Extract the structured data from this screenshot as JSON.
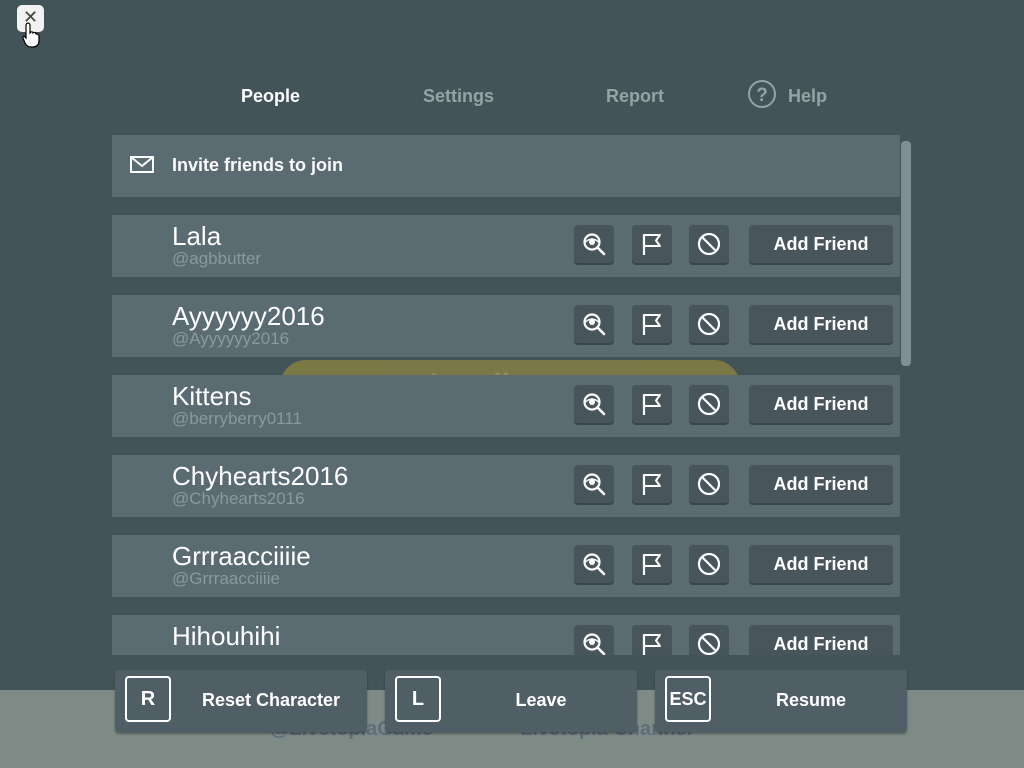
{
  "close": {
    "glyph": "✕"
  },
  "tabs": [
    {
      "label": "People",
      "active": true
    },
    {
      "label": "Settings",
      "active": false
    },
    {
      "label": "Report",
      "active": false
    },
    {
      "label": "Help",
      "active": false,
      "icon": "question-circle-icon"
    }
  ],
  "help_icon_glyph": "?",
  "invite": {
    "label": "Invite friends to join",
    "icon": "envelope-icon"
  },
  "players": [
    {
      "name": "Lala",
      "username": "@agbbutter",
      "action": "Add Friend"
    },
    {
      "name": "Ayyyyyy2016",
      "username": "@Ayyyyyy2016",
      "action": "Add Friend"
    },
    {
      "name": "Kittens",
      "username": "@berryberry0111",
      "action": "Add Friend"
    },
    {
      "name": "Chyhearts2016",
      "username": "@Chyhearts2016",
      "action": "Add Friend"
    },
    {
      "name": "Grrraacciiiie",
      "username": "@Grrraacciiiie",
      "action": "Add Friend"
    },
    {
      "name": "Hihouhihi",
      "username": "",
      "action": "Add Friend"
    }
  ],
  "row_icons": [
    "inspect-icon",
    "flag-icon",
    "block-icon"
  ],
  "bottom_buttons": [
    {
      "key": "R",
      "label": "Reset Character"
    },
    {
      "key": "L",
      "label": "Leave"
    },
    {
      "key": "ESC",
      "label": "Resume"
    }
  ],
  "background": {
    "loading_text": "Loading...",
    "social_left": "@LivetopiaGame",
    "social_right": "Livetopia Channel"
  },
  "colors": {
    "backdrop": "#425458",
    "row": "#5b6b72",
    "button": "#48565c",
    "tab_inactive": "#95a3a4"
  }
}
